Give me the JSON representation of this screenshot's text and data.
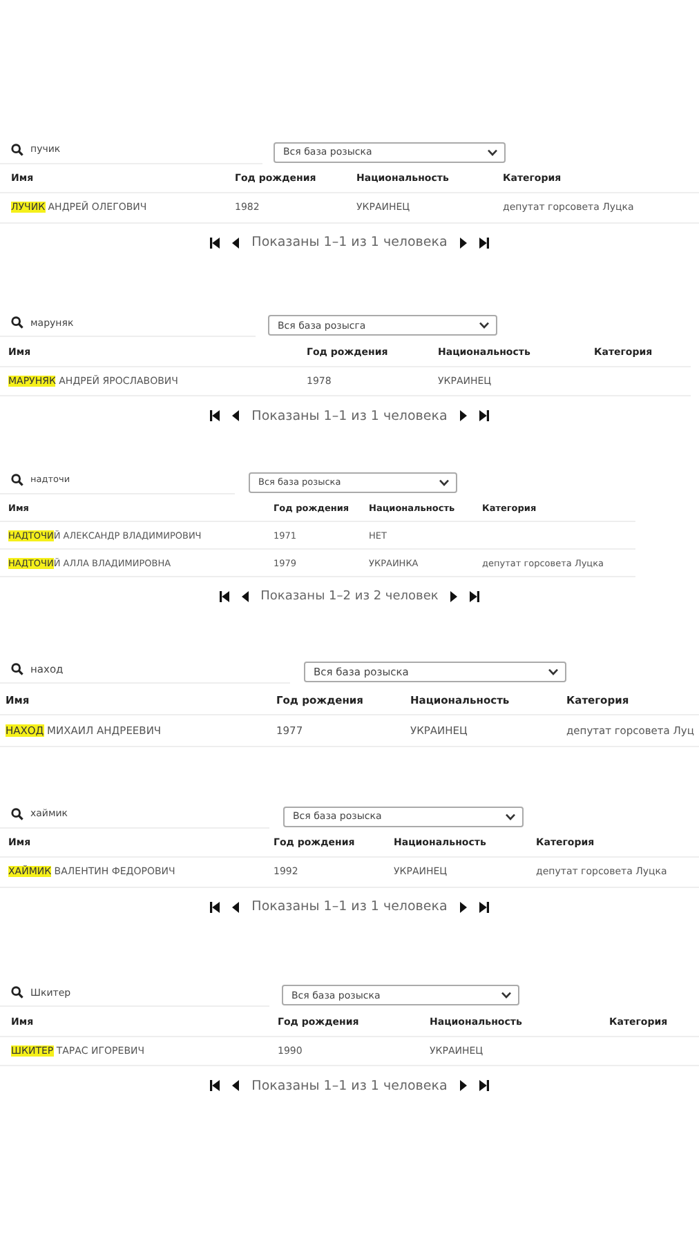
{
  "panels": [
    {
      "query": "пучик",
      "filter": "Вся база розыска",
      "columns": [
        "Имя",
        "Год рождения",
        "Национальность",
        "Категория"
      ],
      "rows": [
        {
          "match": "ЛУЧИК",
          "rest": " АНДРЕЙ ОЛЕГОВИЧ",
          "year": "1982",
          "nationality": "УКРАИНЕЦ",
          "category": "депутат горсовета Луцка"
        }
      ],
      "pagination": "Показаны 1–1 из 1 человека"
    },
    {
      "query": "маруняк",
      "filter": "Вся база розысга",
      "columns": [
        "Имя",
        "Год рождения",
        "Национальность",
        "Категория"
      ],
      "rows": [
        {
          "match": "МАРУНЯК",
          "rest": " АНДРЕЙ ЯРОСЛАВОВИЧ",
          "year": "1978",
          "nationality": "УКРАИНЕЦ"
        }
      ],
      "pagination": "Показаны 1–1 из 1 человека"
    },
    {
      "query": "надточи",
      "filter": "Вся база розыска",
      "columns": [
        "Имя",
        "Год рождения",
        "Национальность",
        "Категория"
      ],
      "rows": [
        {
          "match": "НАДТОЧИ",
          "rest": "Й АЛЕКСАНДР ВЛАДИМИРОВИЧ",
          "year": "1971",
          "nationality": "НЕТ"
        },
        {
          "match": "НАДТОЧИ",
          "rest": "Й АЛЛА ВЛАДИМИРОВНА",
          "year": "1979",
          "nationality": "УКРАИНКА",
          "category": "депутат горсовета Луцка"
        }
      ],
      "pagination": "Показаны 1–2 из 2 человек"
    },
    {
      "query": "наход",
      "filter": "Вся база розыска",
      "columns": [
        "Имя",
        "Год рождения",
        "Национальность",
        "Категория"
      ],
      "rows": [
        {
          "match": "НАХОД",
          "rest": " МИХАИЛ АНДРЕЕВИЧ",
          "year": "1977",
          "nationality": "УКРАИНЕЦ",
          "category": "депутат горсовета Луц"
        }
      ]
    },
    {
      "query": "хаймик",
      "filter": "Вся база розыска",
      "columns": [
        "Имя",
        "Год рождения",
        "Национальность",
        "Категория"
      ],
      "rows": [
        {
          "match": "ХАЙМИК",
          "rest": " ВАЛЕНТИН ФЕДОРОВИЧ",
          "year": "1992",
          "nationality": "УКРАИНЕЦ",
          "category": "депутат горсовета Луцка"
        }
      ],
      "pagination": "Показаны 1–1 из 1 человека"
    },
    {
      "query": "Шкитер",
      "filter": "Вся база розыска",
      "columns": [
        "Имя",
        "Год рождения",
        "Национальность",
        "Категория"
      ],
      "rows": [
        {
          "match": "ШКИТЕР",
          "rest": " ТАРАС ИГОРЕВИЧ",
          "year": "1990",
          "nationality": "УКРАИНЕЦ"
        }
      ],
      "pagination": "Показаны 1–1 из 1 человека"
    }
  ]
}
